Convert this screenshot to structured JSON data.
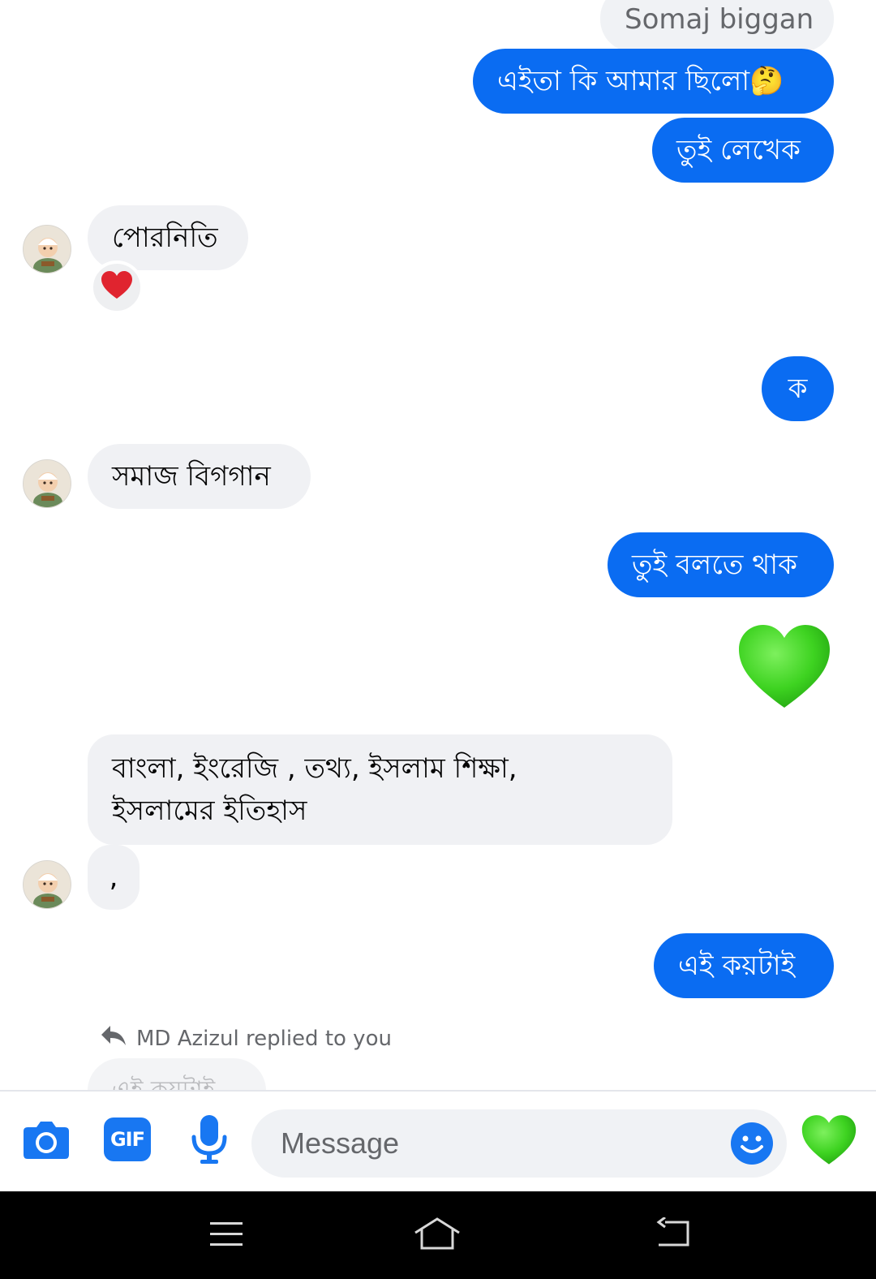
{
  "thread": {
    "messages": [
      {
        "id": "m0",
        "text": "Somaj biggan"
      },
      {
        "id": "m1",
        "text": "এইতা কি আমার ছিলো🤔"
      },
      {
        "id": "m2",
        "text": "তুই লেখেক"
      },
      {
        "id": "m3",
        "text": "পোরনিতি"
      },
      {
        "id": "m4",
        "text": "ক"
      },
      {
        "id": "m5",
        "text": "সমাজ বিগগান"
      },
      {
        "id": "m6",
        "text": "তুই বলতে থাক"
      },
      {
        "id": "m8",
        "line1": "বাংলা, ইংরেজি ,  তথ্য, ইসলাম শিক্ষা,",
        "line2": "ইসলামের ইতিহাস"
      },
      {
        "id": "m9",
        "text": ","
      },
      {
        "id": "m10",
        "text": "এই কয়টাই"
      }
    ],
    "reply_note": "MD Azizul replied to you",
    "quoted_reply": "এই কয়টাই"
  },
  "composer": {
    "placeholder": "Message",
    "gif_label": "GIF"
  },
  "icons": {
    "camera": "camera-icon",
    "gif": "gif-icon",
    "mic": "microphone-icon",
    "emoji": "emoji-icon",
    "like": "green-heart-icon",
    "reaction": "red-heart-icon",
    "reply": "reply-arrow-icon",
    "nav_menu": "menu-icon",
    "nav_home": "home-icon",
    "nav_back": "back-icon"
  },
  "colors": {
    "outgoing_bubble": "#0a6cf2",
    "incoming_bubble": "#f0f1f4",
    "accent": "#1877f2",
    "green_heart": "#3ed321",
    "red_heart": "#e0242f"
  }
}
